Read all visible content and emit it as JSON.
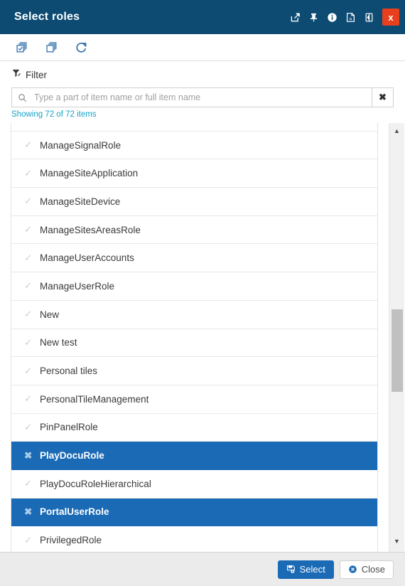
{
  "window": {
    "title": "Select roles",
    "titlebar_icons": [
      {
        "name": "open-in-new-window-icon",
        "label": "Open in new window"
      },
      {
        "name": "pin-icon",
        "label": "Pin"
      },
      {
        "name": "info-icon",
        "label": "Info"
      },
      {
        "name": "export-pdf-icon",
        "label": "Export to PDF"
      },
      {
        "name": "toggle-panel-icon",
        "label": "Toggle panel"
      }
    ],
    "close_label": "x",
    "close_color": "#e8401c",
    "titlebar_color": "#0d4b72"
  },
  "toolbar": {
    "buttons": [
      {
        "name": "select-all-button",
        "label": "Select all"
      },
      {
        "name": "deselect-all-button",
        "label": "Deselect all"
      },
      {
        "name": "refresh-button",
        "label": "Refresh"
      }
    ],
    "icon_color": "#2b6aa8"
  },
  "filter": {
    "label": "Filter",
    "placeholder": "Type a part of item name or full item name",
    "value": "",
    "clear_label": "✖",
    "showing_text": "Showing 72 of 72 items",
    "showing_color": "#14a3c7",
    "shown_count": 72,
    "total_count": 72
  },
  "list": {
    "selected_color": "#1a6ab5",
    "selected_icon": "✖",
    "unselected_icon": "✓",
    "items": [
      {
        "label": "ManageSignalRole",
        "selected": false
      },
      {
        "label": "ManageSiteApplication",
        "selected": false
      },
      {
        "label": "ManageSiteDevice",
        "selected": false
      },
      {
        "label": "ManageSitesAreasRole",
        "selected": false
      },
      {
        "label": "ManageUserAccounts",
        "selected": false
      },
      {
        "label": "ManageUserRole",
        "selected": false
      },
      {
        "label": "New",
        "selected": false
      },
      {
        "label": "New test",
        "selected": false
      },
      {
        "label": "Personal tiles",
        "selected": false
      },
      {
        "label": "PersonalTileManagement",
        "selected": false
      },
      {
        "label": "PinPanelRole",
        "selected": false
      },
      {
        "label": "PlayDocuRole",
        "selected": true
      },
      {
        "label": "PlayDocuRoleHierarchical",
        "selected": false
      },
      {
        "label": "PortalUserRole",
        "selected": true
      },
      {
        "label": "PrivilegedRole",
        "selected": false
      }
    ]
  },
  "scrollbar": {
    "up_arrow": "▲",
    "down_arrow": "▼"
  },
  "footer": {
    "select_label": "Select",
    "close_label": "Close"
  }
}
